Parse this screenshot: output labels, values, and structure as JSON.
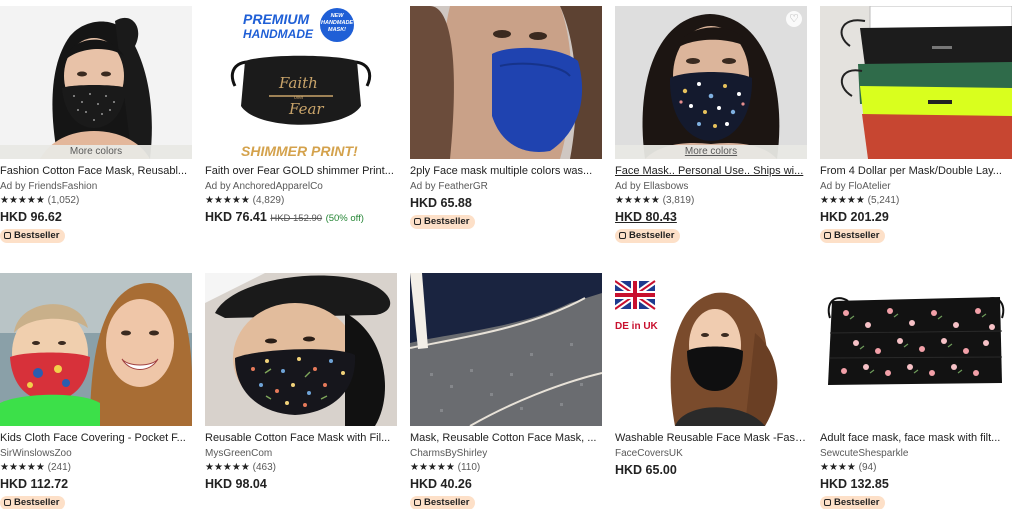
{
  "more_colors_label": "More colors",
  "bestseller_label": "Bestseller",
  "products": [
    {
      "title": "Fashion Cotton Face Mask, Reusabl...",
      "shop": "Ad by FriendsFashion",
      "stars": "★★★★★",
      "reviews": "(1,052)",
      "price": "HKD 96.62"
    },
    {
      "title": "Faith over Fear GOLD shimmer Print...",
      "shop": "Ad by AnchoredApparelCo",
      "stars": "★★★★★",
      "reviews": "(4,829)",
      "price": "HKD 76.41",
      "original_price": "HKD 152.90",
      "discount": "(50% off)",
      "image_text": {
        "premium": "PREMIUM",
        "handmade": "HANDMADE",
        "burst": "NEW HANDMADE MASK!",
        "script1": "Faith",
        "script_over": "over",
        "script2": "Fear",
        "shimmer": "SHIMMER PRINT!"
      }
    },
    {
      "title": "2ply Face mask multiple colors was...",
      "shop": "Ad by FeatherGR",
      "price": "HKD 65.88"
    },
    {
      "title": "Face Mask.. Personal Use.. Ships wi...",
      "shop": "Ad by Ellasbows",
      "stars": "★★★★★",
      "reviews": "(3,819)",
      "price": "HKD 80.43"
    },
    {
      "title": "From 4 Dollar per Mask/Double Lay...",
      "shop": "Ad by FloAtelier",
      "stars": "★★★★★",
      "reviews": "(5,241)",
      "price": "HKD 201.29"
    },
    {
      "title": "Kids Cloth Face Covering - Pocket F...",
      "shop": "SirWinslowsZoo",
      "stars": "★★★★★",
      "reviews": "(241)",
      "price": "HKD 112.72"
    },
    {
      "title": "Reusable Cotton Face Mask with Fil...",
      "shop": "MysGreenCom",
      "stars": "★★★★★",
      "reviews": "(463)",
      "price": "HKD 98.04"
    },
    {
      "title": "Mask, Reusable Cotton Face Mask, ...",
      "shop": "CharmsByShirley",
      "stars": "★★★★★",
      "reviews": "(110)",
      "price": "HKD 40.26"
    },
    {
      "title": "Washable Reusable Face Mask -Fast...",
      "shop": "FaceCoversUK",
      "price": "HKD 65.00",
      "image_text": {
        "flag_caption": "DE in UK"
      }
    },
    {
      "title": "Adult face mask, face mask with filt...",
      "shop": "SewcuteShesparkle",
      "stars": "★★★★",
      "reviews": "(94)",
      "price": "HKD 132.85"
    }
  ]
}
